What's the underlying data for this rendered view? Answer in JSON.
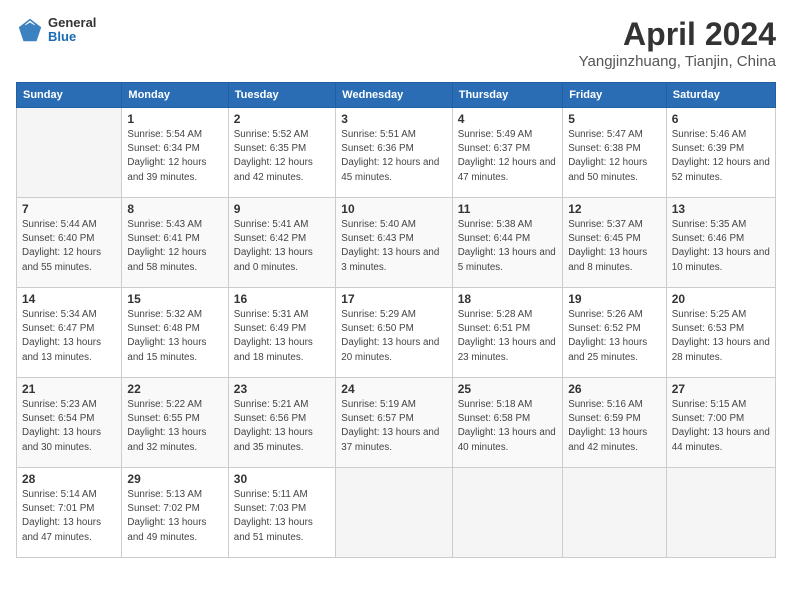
{
  "header": {
    "logo_general": "General",
    "logo_blue": "Blue",
    "title": "April 2024",
    "location": "Yangjinzhuang, Tianjin, China"
  },
  "weekdays": [
    "Sunday",
    "Monday",
    "Tuesday",
    "Wednesday",
    "Thursday",
    "Friday",
    "Saturday"
  ],
  "weeks": [
    [
      {
        "day": "",
        "sunrise": "",
        "sunset": "",
        "daylight": ""
      },
      {
        "day": "1",
        "sunrise": "Sunrise: 5:54 AM",
        "sunset": "Sunset: 6:34 PM",
        "daylight": "Daylight: 12 hours and 39 minutes."
      },
      {
        "day": "2",
        "sunrise": "Sunrise: 5:52 AM",
        "sunset": "Sunset: 6:35 PM",
        "daylight": "Daylight: 12 hours and 42 minutes."
      },
      {
        "day": "3",
        "sunrise": "Sunrise: 5:51 AM",
        "sunset": "Sunset: 6:36 PM",
        "daylight": "Daylight: 12 hours and 45 minutes."
      },
      {
        "day": "4",
        "sunrise": "Sunrise: 5:49 AM",
        "sunset": "Sunset: 6:37 PM",
        "daylight": "Daylight: 12 hours and 47 minutes."
      },
      {
        "day": "5",
        "sunrise": "Sunrise: 5:47 AM",
        "sunset": "Sunset: 6:38 PM",
        "daylight": "Daylight: 12 hours and 50 minutes."
      },
      {
        "day": "6",
        "sunrise": "Sunrise: 5:46 AM",
        "sunset": "Sunset: 6:39 PM",
        "daylight": "Daylight: 12 hours and 52 minutes."
      }
    ],
    [
      {
        "day": "7",
        "sunrise": "Sunrise: 5:44 AM",
        "sunset": "Sunset: 6:40 PM",
        "daylight": "Daylight: 12 hours and 55 minutes."
      },
      {
        "day": "8",
        "sunrise": "Sunrise: 5:43 AM",
        "sunset": "Sunset: 6:41 PM",
        "daylight": "Daylight: 12 hours and 58 minutes."
      },
      {
        "day": "9",
        "sunrise": "Sunrise: 5:41 AM",
        "sunset": "Sunset: 6:42 PM",
        "daylight": "Daylight: 13 hours and 0 minutes."
      },
      {
        "day": "10",
        "sunrise": "Sunrise: 5:40 AM",
        "sunset": "Sunset: 6:43 PM",
        "daylight": "Daylight: 13 hours and 3 minutes."
      },
      {
        "day": "11",
        "sunrise": "Sunrise: 5:38 AM",
        "sunset": "Sunset: 6:44 PM",
        "daylight": "Daylight: 13 hours and 5 minutes."
      },
      {
        "day": "12",
        "sunrise": "Sunrise: 5:37 AM",
        "sunset": "Sunset: 6:45 PM",
        "daylight": "Daylight: 13 hours and 8 minutes."
      },
      {
        "day": "13",
        "sunrise": "Sunrise: 5:35 AM",
        "sunset": "Sunset: 6:46 PM",
        "daylight": "Daylight: 13 hours and 10 minutes."
      }
    ],
    [
      {
        "day": "14",
        "sunrise": "Sunrise: 5:34 AM",
        "sunset": "Sunset: 6:47 PM",
        "daylight": "Daylight: 13 hours and 13 minutes."
      },
      {
        "day": "15",
        "sunrise": "Sunrise: 5:32 AM",
        "sunset": "Sunset: 6:48 PM",
        "daylight": "Daylight: 13 hours and 15 minutes."
      },
      {
        "day": "16",
        "sunrise": "Sunrise: 5:31 AM",
        "sunset": "Sunset: 6:49 PM",
        "daylight": "Daylight: 13 hours and 18 minutes."
      },
      {
        "day": "17",
        "sunrise": "Sunrise: 5:29 AM",
        "sunset": "Sunset: 6:50 PM",
        "daylight": "Daylight: 13 hours and 20 minutes."
      },
      {
        "day": "18",
        "sunrise": "Sunrise: 5:28 AM",
        "sunset": "Sunset: 6:51 PM",
        "daylight": "Daylight: 13 hours and 23 minutes."
      },
      {
        "day": "19",
        "sunrise": "Sunrise: 5:26 AM",
        "sunset": "Sunset: 6:52 PM",
        "daylight": "Daylight: 13 hours and 25 minutes."
      },
      {
        "day": "20",
        "sunrise": "Sunrise: 5:25 AM",
        "sunset": "Sunset: 6:53 PM",
        "daylight": "Daylight: 13 hours and 28 minutes."
      }
    ],
    [
      {
        "day": "21",
        "sunrise": "Sunrise: 5:23 AM",
        "sunset": "Sunset: 6:54 PM",
        "daylight": "Daylight: 13 hours and 30 minutes."
      },
      {
        "day": "22",
        "sunrise": "Sunrise: 5:22 AM",
        "sunset": "Sunset: 6:55 PM",
        "daylight": "Daylight: 13 hours and 32 minutes."
      },
      {
        "day": "23",
        "sunrise": "Sunrise: 5:21 AM",
        "sunset": "Sunset: 6:56 PM",
        "daylight": "Daylight: 13 hours and 35 minutes."
      },
      {
        "day": "24",
        "sunrise": "Sunrise: 5:19 AM",
        "sunset": "Sunset: 6:57 PM",
        "daylight": "Daylight: 13 hours and 37 minutes."
      },
      {
        "day": "25",
        "sunrise": "Sunrise: 5:18 AM",
        "sunset": "Sunset: 6:58 PM",
        "daylight": "Daylight: 13 hours and 40 minutes."
      },
      {
        "day": "26",
        "sunrise": "Sunrise: 5:16 AM",
        "sunset": "Sunset: 6:59 PM",
        "daylight": "Daylight: 13 hours and 42 minutes."
      },
      {
        "day": "27",
        "sunrise": "Sunrise: 5:15 AM",
        "sunset": "Sunset: 7:00 PM",
        "daylight": "Daylight: 13 hours and 44 minutes."
      }
    ],
    [
      {
        "day": "28",
        "sunrise": "Sunrise: 5:14 AM",
        "sunset": "Sunset: 7:01 PM",
        "daylight": "Daylight: 13 hours and 47 minutes."
      },
      {
        "day": "29",
        "sunrise": "Sunrise: 5:13 AM",
        "sunset": "Sunset: 7:02 PM",
        "daylight": "Daylight: 13 hours and 49 minutes."
      },
      {
        "day": "30",
        "sunrise": "Sunrise: 5:11 AM",
        "sunset": "Sunset: 7:03 PM",
        "daylight": "Daylight: 13 hours and 51 minutes."
      },
      {
        "day": "",
        "sunrise": "",
        "sunset": "",
        "daylight": ""
      },
      {
        "day": "",
        "sunrise": "",
        "sunset": "",
        "daylight": ""
      },
      {
        "day": "",
        "sunrise": "",
        "sunset": "",
        "daylight": ""
      },
      {
        "day": "",
        "sunrise": "",
        "sunset": "",
        "daylight": ""
      }
    ]
  ]
}
